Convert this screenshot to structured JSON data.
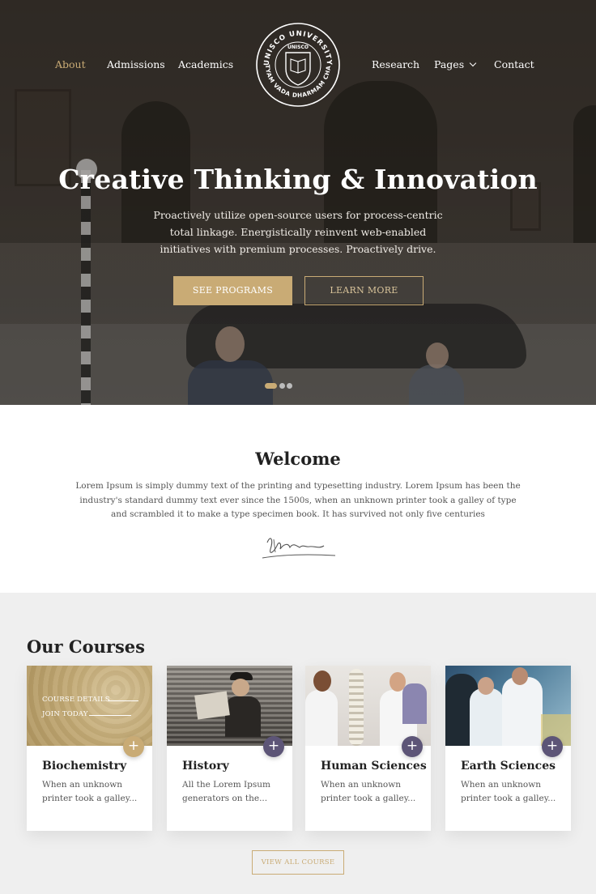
{
  "nav": {
    "left": [
      "About",
      "Admissions",
      "Academics"
    ],
    "right": [
      "Research",
      "Pages",
      "Contact"
    ]
  },
  "logo": {
    "arc_top": "UNISCO UNIVERSITY",
    "arc_bottom": "SATYAM VADA DHARMAM CHARA",
    "shield_text": "UNISCO"
  },
  "hero": {
    "title": "Creative Thinking & Innovation",
    "text": "Proactively utilize open-source users for process-centric total linkage. Energistically reinvent web-enabled initiatives with premium processes. Proactively drive.",
    "primary_button": "SEE PROGRAMS",
    "secondary_button": "LEARN MORE",
    "slides_total": 3,
    "slide_active": 1
  },
  "welcome": {
    "title": "Welcome",
    "text": "Lorem Ipsum is simply dummy text of the printing and typesetting industry. Lorem Ipsum has been the industry's standard dummy text ever since the 1500s, when an unknown printer took a galley of type and scrambled it to make a type specimen book. It has survived not only five centuries"
  },
  "courses": {
    "title": "Our Courses",
    "overlay": {
      "details": "COURSE DETAILS",
      "join": "JOIN TODAY"
    },
    "plus_symbol": "+",
    "items": [
      {
        "title": "Biochemistry",
        "desc": "When an unknown printer took a galley...",
        "accent": "#c9ab75"
      },
      {
        "title": "History",
        "desc": "All the Lorem Ipsum generators on the...",
        "accent": "#5d5577"
      },
      {
        "title": "Human Sciences",
        "desc": "When an unknown printer took a galley...",
        "accent": "#5d5577"
      },
      {
        "title": "Earth Sciences",
        "desc": "When an unknown printer took a galley...",
        "accent": "#5d5577"
      }
    ],
    "view_all": "VIEW ALL COURSE"
  },
  "colors": {
    "gold": "#c9ab75",
    "purple": "#5d5577",
    "hero_overlay": "#28241f"
  }
}
